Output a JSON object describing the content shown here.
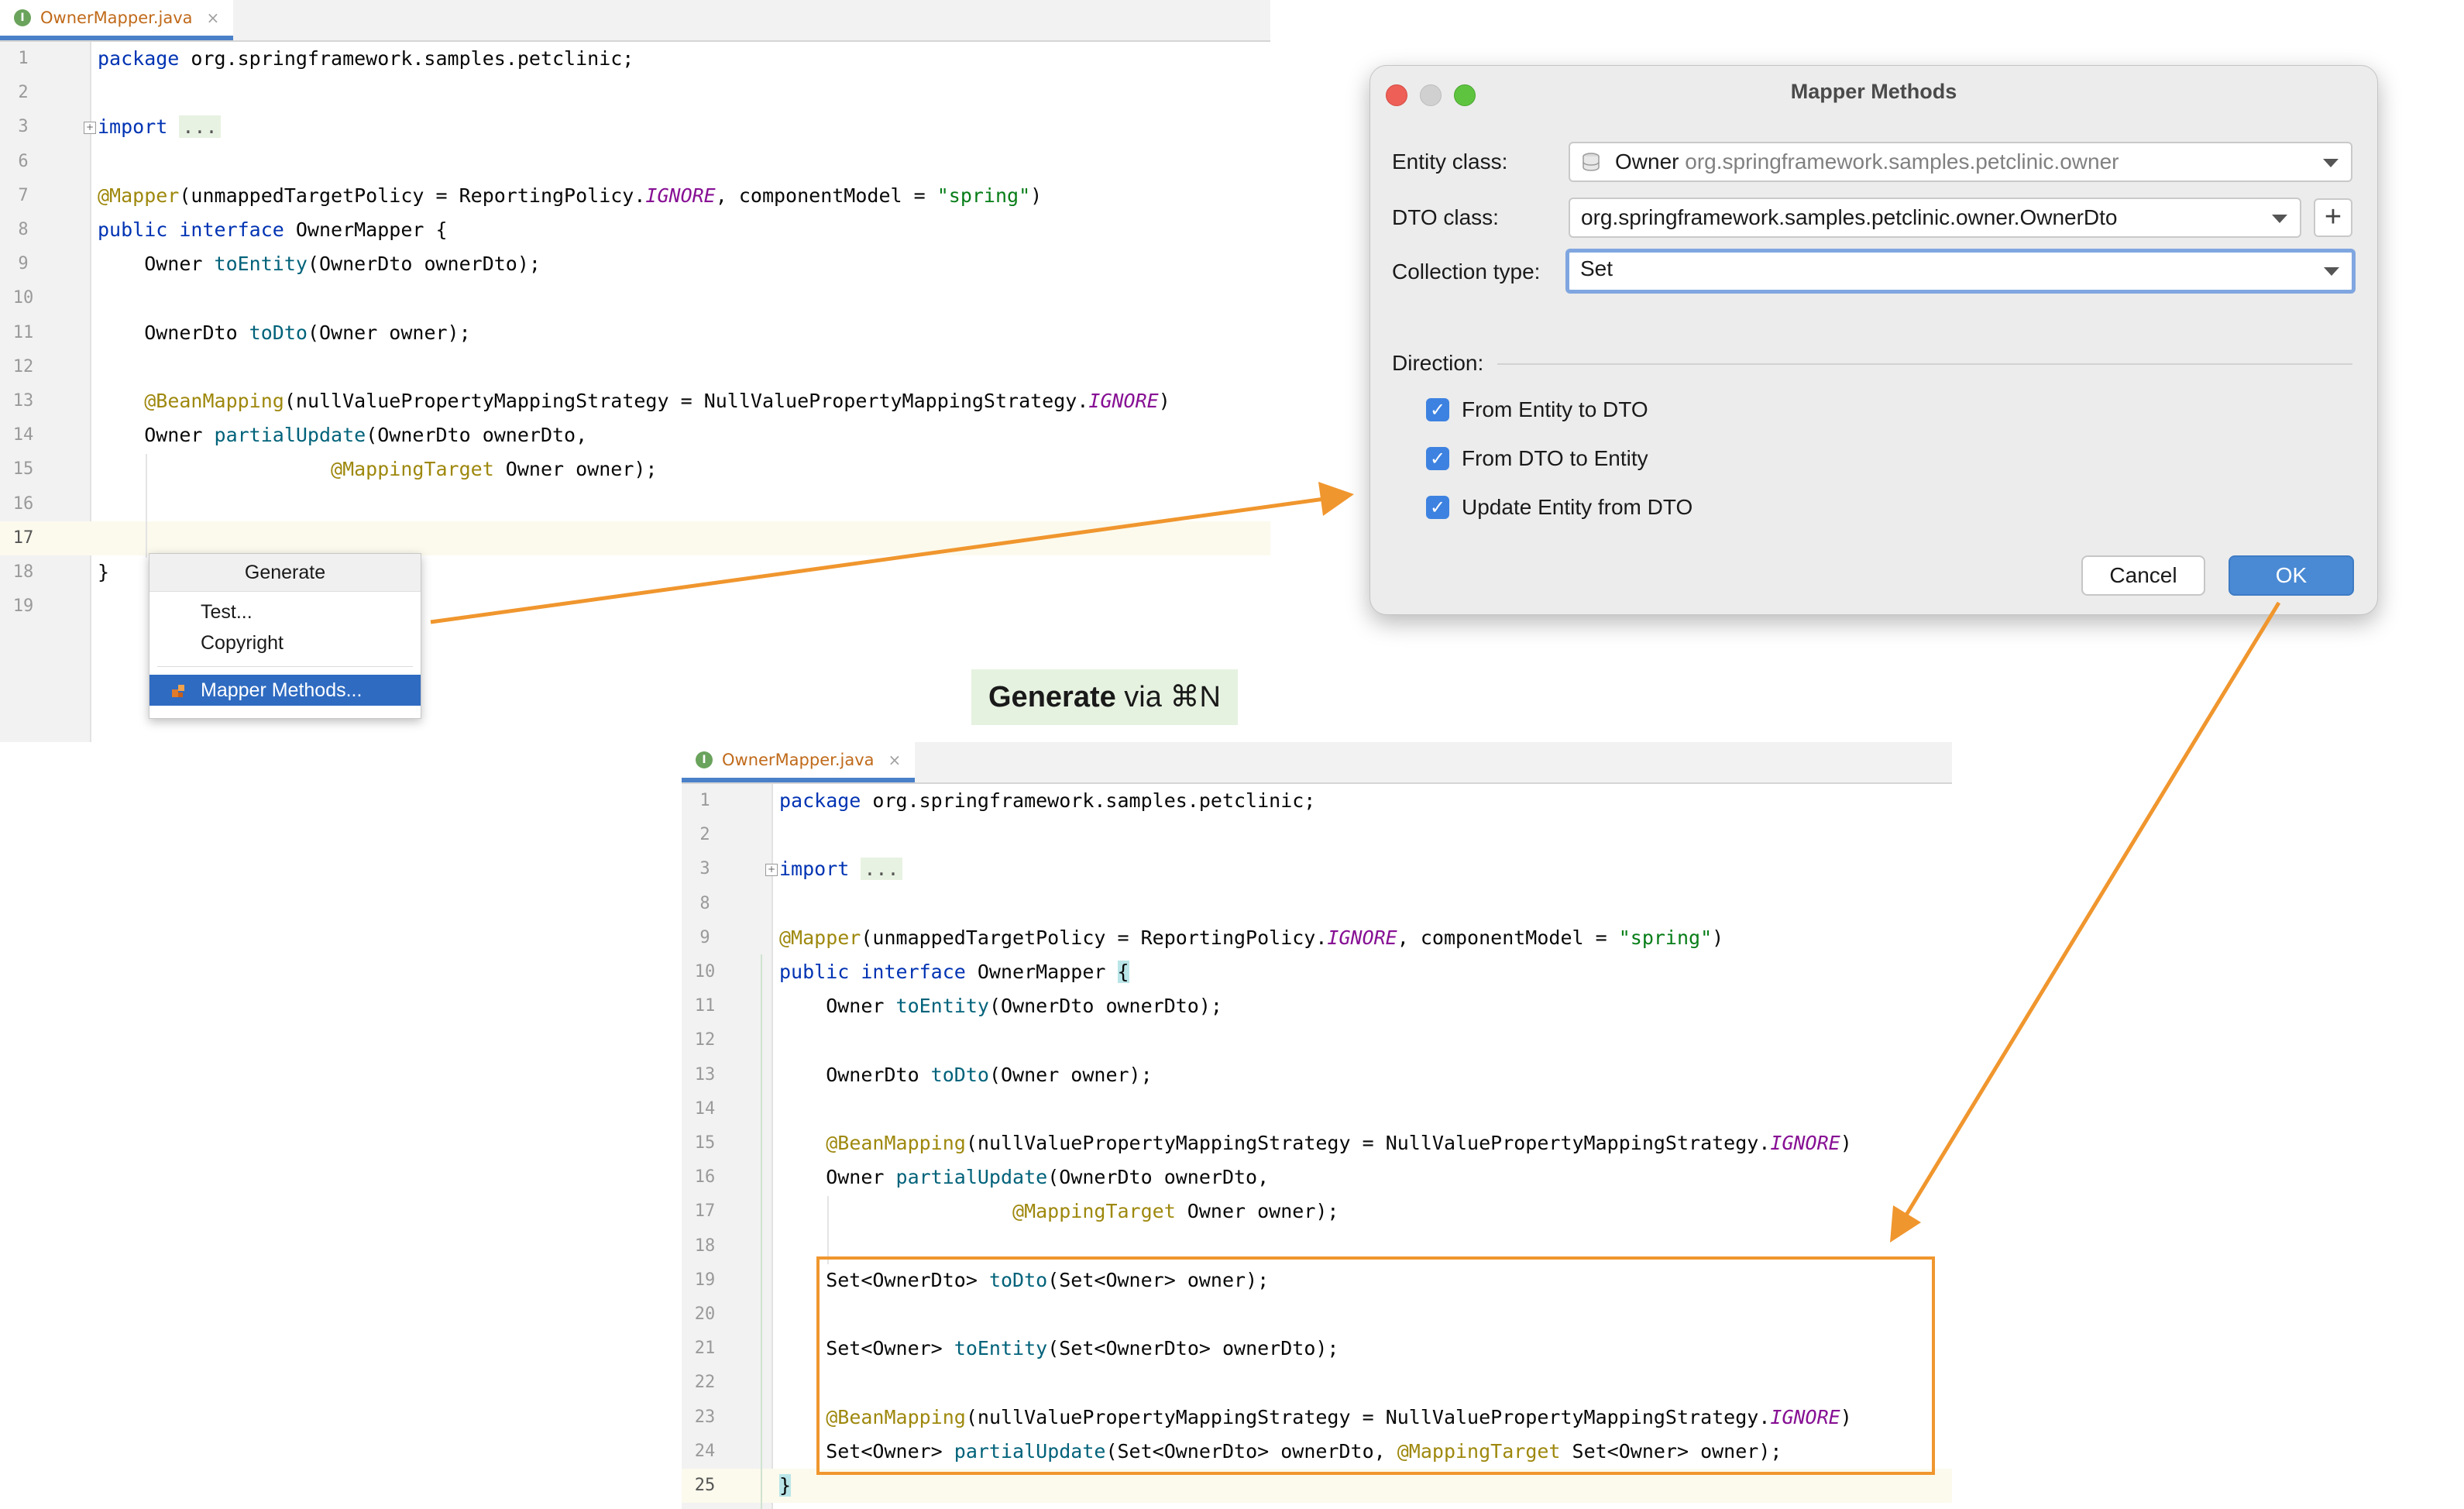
{
  "caption": {
    "bold": "Generate",
    "rest": " via ⌘N"
  },
  "editor_top": {
    "tab": {
      "label": "OwnerMapper.java",
      "badge": "I",
      "close": "×"
    },
    "lines": [
      {
        "n": "1",
        "html": "<span class='kw'>package</span> org.springframework.samples.petclinic;"
      },
      {
        "n": "2",
        "html": ""
      },
      {
        "n": "3",
        "html": "<span class='kw'>import</span> <span class='fold'>...</span>",
        "foldmark": true
      },
      {
        "n": "6",
        "html": ""
      },
      {
        "n": "7",
        "html": "<span class='ann'>@Mapper</span>(unmappedTargetPolicy = ReportingPolicy.<span class='cst'>IGNORE</span>, componentModel = <span class='str'>\"spring\"</span>)"
      },
      {
        "n": "8",
        "html": "<span class='kw'>public interface</span> OwnerMapper {"
      },
      {
        "n": "9",
        "html": "    Owner <span class='mth'>toEntity</span>(OwnerDto ownerDto);"
      },
      {
        "n": "10",
        "html": ""
      },
      {
        "n": "11",
        "html": "    OwnerDto <span class='mth'>toDto</span>(Owner owner);"
      },
      {
        "n": "12",
        "html": ""
      },
      {
        "n": "13",
        "html": "    <span class='ann'>@BeanMapping</span>(nullValuePropertyMappingStrategy = NullValuePropertyMappingStrategy.<span class='cst'>IGNORE</span>)"
      },
      {
        "n": "14",
        "html": "    Owner <span class='mth'>partialUpdate</span>(OwnerDto ownerDto,"
      },
      {
        "n": "15",
        "html": "                    <span class='ann'>@MappingTarget</span> Owner owner);"
      },
      {
        "n": "16",
        "html": ""
      },
      {
        "n": "17",
        "html": "",
        "current": true
      },
      {
        "n": "18",
        "html": "}"
      },
      {
        "n": "19",
        "html": ""
      }
    ]
  },
  "generate_menu": {
    "title": "Generate",
    "items": [
      "Test...",
      "Copyright"
    ],
    "selected": "Mapper Methods..."
  },
  "dialog": {
    "title": "Mapper Methods",
    "entity_label": "Entity class:",
    "entity_class": "Owner",
    "entity_package": "org.springframework.samples.petclinic.owner",
    "dto_label": "DTO class:",
    "dto_class": "org.springframework.samples.petclinic.owner.OwnerDto",
    "plus": "+",
    "collection_label": "Collection type:",
    "collection_value": "Set",
    "direction_label": "Direction:",
    "checks": [
      "From Entity to DTO",
      "From DTO to Entity",
      "Update Entity from DTO"
    ],
    "check_glyph": "✓",
    "cancel": "Cancel",
    "ok": "OK"
  },
  "editor_bottom": {
    "tab": {
      "label": "OwnerMapper.java",
      "badge": "I",
      "close": "×"
    },
    "lines": [
      {
        "n": "1",
        "html": "<span class='kw'>package</span> org.springframework.samples.petclinic;"
      },
      {
        "n": "2",
        "html": ""
      },
      {
        "n": "3",
        "html": "<span class='kw'>import</span> <span class='fold'>...</span>",
        "foldmark": true
      },
      {
        "n": "8",
        "html": ""
      },
      {
        "n": "9",
        "html": "<span class='ann'>@Mapper</span>(unmappedTargetPolicy = ReportingPolicy.<span class='cst'>IGNORE</span>, componentModel = <span class='str'>\"spring\"</span>)"
      },
      {
        "n": "10",
        "html": "<span class='kw'>public interface</span> OwnerMapper <span class='brace-hl'>{</span>"
      },
      {
        "n": "11",
        "html": "    Owner <span class='mth'>toEntity</span>(OwnerDto ownerDto);"
      },
      {
        "n": "12",
        "html": ""
      },
      {
        "n": "13",
        "html": "    OwnerDto <span class='mth'>toDto</span>(Owner owner);"
      },
      {
        "n": "14",
        "html": ""
      },
      {
        "n": "15",
        "html": "    <span class='ann'>@BeanMapping</span>(nullValuePropertyMappingStrategy = NullValuePropertyMappingStrategy.<span class='cst'>IGNORE</span>)"
      },
      {
        "n": "16",
        "html": "    Owner <span class='mth'>partialUpdate</span>(OwnerDto ownerDto,"
      },
      {
        "n": "17",
        "html": "                    <span class='ann'>@MappingTarget</span> Owner owner);"
      },
      {
        "n": "18",
        "html": ""
      },
      {
        "n": "19",
        "html": "    Set&lt;OwnerDto&gt; <span class='mth'>toDto</span>(Set&lt;Owner&gt; owner);"
      },
      {
        "n": "20",
        "html": ""
      },
      {
        "n": "21",
        "html": "    Set&lt;Owner&gt; <span class='mth'>toEntity</span>(Set&lt;OwnerDto&gt; ownerDto);"
      },
      {
        "n": "22",
        "html": ""
      },
      {
        "n": "23",
        "html": "    <span class='ann'>@BeanMapping</span>(nullValuePropertyMappingStrategy = NullValuePropertyMappingStrategy.<span class='cst'>IGNORE</span>)"
      },
      {
        "n": "24",
        "html": "    Set&lt;Owner&gt; <span class='mth'>partialUpdate</span>(Set&lt;OwnerDto&gt; ownerDto, <span class='ann'>@MappingTarget</span> Set&lt;Owner&gt; owner);"
      },
      {
        "n": "25",
        "html": "<span class='brace-hl'>}</span>",
        "current": true
      }
    ]
  },
  "colors": {
    "arrow": "#f0962e",
    "accent": "#2f6bc1",
    "checkbox": "#3d82e0"
  }
}
